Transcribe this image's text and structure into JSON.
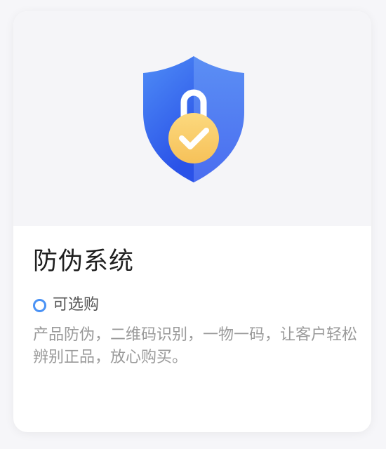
{
  "card": {
    "title": "防伪系统",
    "tag": "可选购",
    "description": "产品防伪，二维码识别，一物一码，让客户轻松辨别正品，放心购买。",
    "icon": "shield-lock-check-icon"
  },
  "colors": {
    "shield_blue": "#3a6ff2",
    "lock_yellow": "#f8c661",
    "tag_ring": "#4a92f5"
  }
}
